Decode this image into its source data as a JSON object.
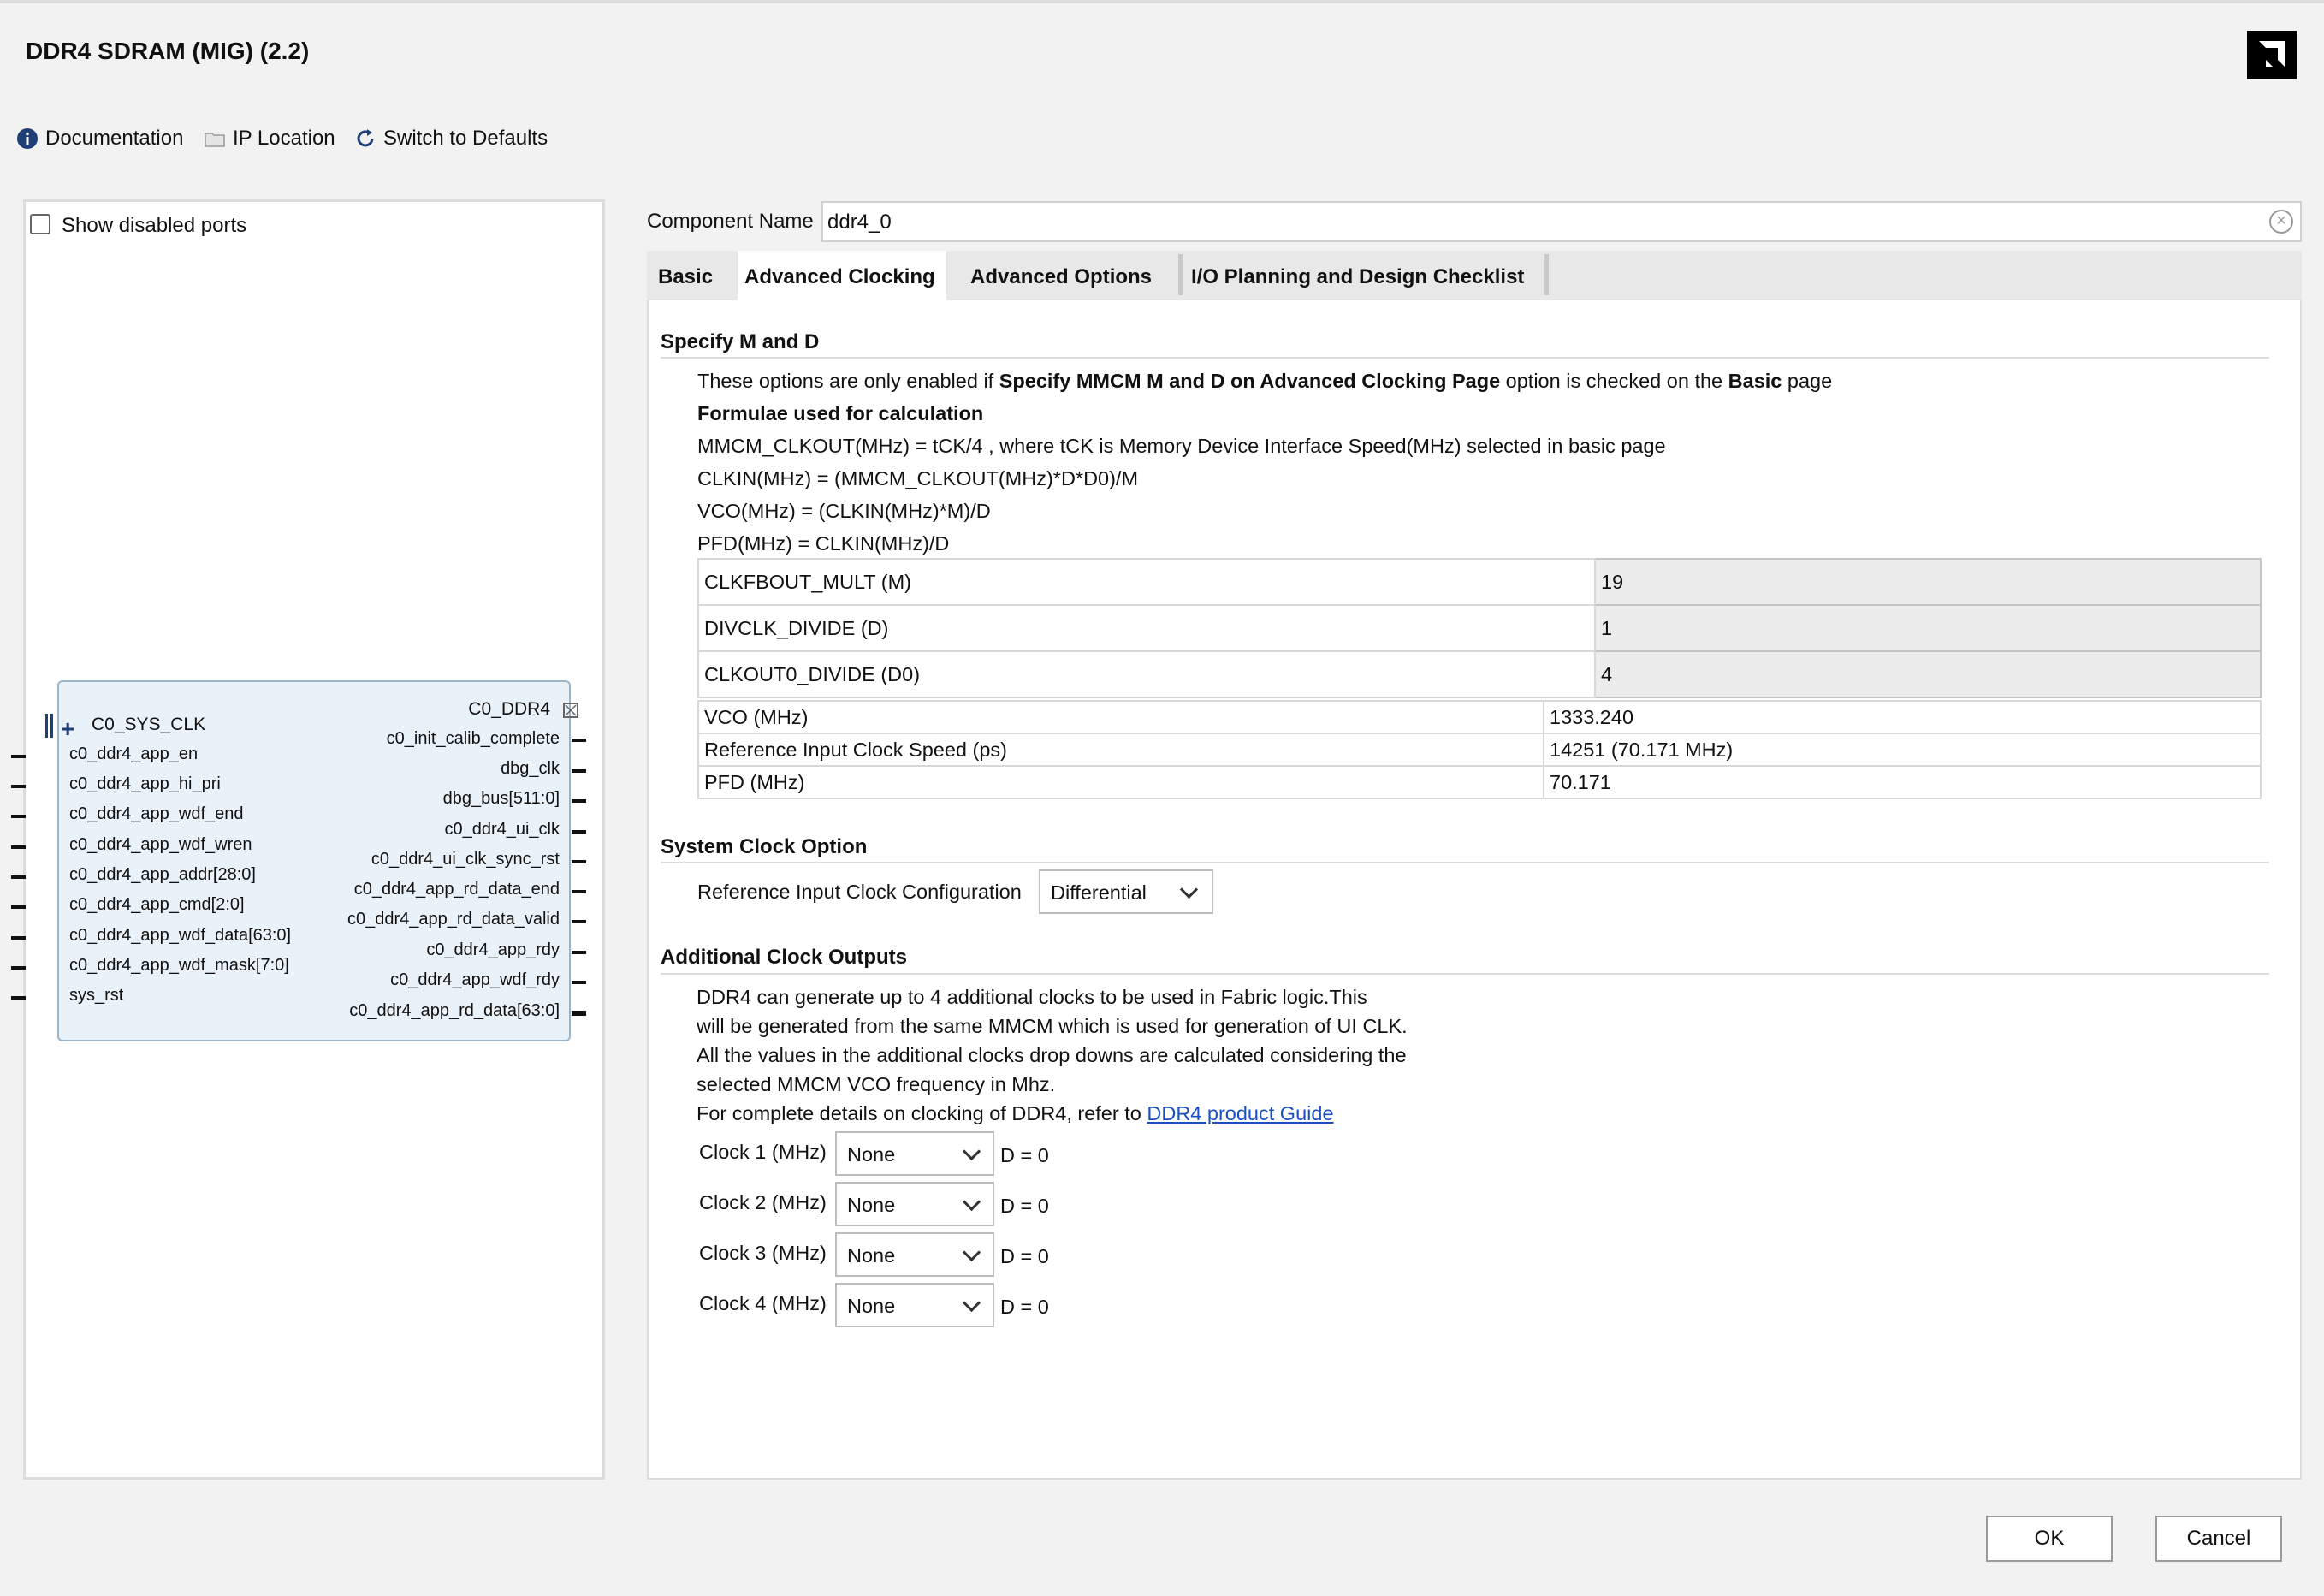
{
  "window": {
    "title": "DDR4 SDRAM (MIG) (2.2)",
    "logo": "amd-logo-icon"
  },
  "toolbar": {
    "documentation": "Documentation",
    "ip_location": "IP Location",
    "switch_defaults": "Switch to Defaults"
  },
  "left_panel": {
    "show_disabled_ports": "Show disabled ports",
    "show_disabled_checked": false,
    "block": {
      "interface_in": "C0_SYS_CLK",
      "interface_out": "C0_DDR4",
      "left_ports": [
        "c0_ddr4_app_en",
        "c0_ddr4_app_hi_pri",
        "c0_ddr4_app_wdf_end",
        "c0_ddr4_app_wdf_wren",
        "c0_ddr4_app_addr[28:0]",
        "c0_ddr4_app_cmd[2:0]",
        "c0_ddr4_app_wdf_data[63:0]",
        "c0_ddr4_app_wdf_mask[7:0]",
        "sys_rst"
      ],
      "right_ports": [
        "c0_init_calib_complete",
        "dbg_clk",
        "dbg_bus[511:0]",
        "c0_ddr4_ui_clk",
        "c0_ddr4_ui_clk_sync_rst",
        "c0_ddr4_app_rd_data_end",
        "c0_ddr4_app_rd_data_valid",
        "c0_ddr4_app_rdy",
        "c0_ddr4_app_wdf_rdy",
        "c0_ddr4_app_rd_data[63:0]"
      ]
    }
  },
  "component": {
    "label": "Component Name",
    "value": "ddr4_0"
  },
  "tabs": [
    {
      "label": "Basic",
      "active": false
    },
    {
      "label": "Advanced Clocking",
      "active": true
    },
    {
      "label": "Advanced Options",
      "active": false
    },
    {
      "label": "I/O Planning and Design Checklist",
      "active": false
    }
  ],
  "specify_md": {
    "title": "Specify M and D",
    "note_prefix": "These options are only enabled if ",
    "note_bold1": "Specify MMCM M and D on Advanced Clocking Page",
    "note_mid": " option is checked on the ",
    "note_bold2": "Basic",
    "note_suffix": " page",
    "formulae_title": "Formulae used for calculation",
    "formulae": [
      "MMCM_CLKOUT(MHz) = tCK/4 , where tCK is Memory Device Interface Speed(MHz) selected in basic page",
      "CLKIN(MHz) = (MMCM_CLKOUT(MHz)*D*D0)/M",
      "VCO(MHz) = (CLKIN(MHz)*M)/D",
      "PFD(MHz) = CLKIN(MHz)/D"
    ],
    "params": [
      {
        "name": "CLKFBOUT_MULT (M)",
        "value": "19"
      },
      {
        "name": "DIVCLK_DIVIDE (D)",
        "value": "1"
      },
      {
        "name": "CLKOUT0_DIVIDE (D0)",
        "value": "4"
      }
    ],
    "results": [
      {
        "name": "VCO (MHz)",
        "value": "1333.240"
      },
      {
        "name": "Reference Input Clock Speed (ps)",
        "value": "14251 (70.171 MHz)"
      },
      {
        "name": "PFD (MHz)",
        "value": "70.171"
      }
    ]
  },
  "system_clock": {
    "title": "System Clock Option",
    "label": "Reference Input Clock Configuration",
    "value": "Differential"
  },
  "additional_clocks": {
    "title": "Additional Clock Outputs",
    "description": [
      "DDR4 can generate up to 4 additional clocks to be used in Fabric logic.This",
      "will be generated from the same MMCM which is used for generation of UI CLK.",
      "All the values in the additional clocks drop downs are calculated considering the",
      "selected MMCM VCO frequency in Mhz."
    ],
    "guide_prefix": "For complete details on clocking of DDR4, refer to ",
    "guide_link": "DDR4 product Guide",
    "clocks": [
      {
        "label": "Clock 1 (MHz)",
        "value": "None",
        "divider": "D = 0"
      },
      {
        "label": "Clock 2 (MHz)",
        "value": "None",
        "divider": "D = 0"
      },
      {
        "label": "Clock 3 (MHz)",
        "value": "None",
        "divider": "D = 0"
      },
      {
        "label": "Clock 4 (MHz)",
        "value": "None",
        "divider": "D = 0"
      }
    ]
  },
  "buttons": {
    "ok": "OK",
    "cancel": "Cancel"
  }
}
